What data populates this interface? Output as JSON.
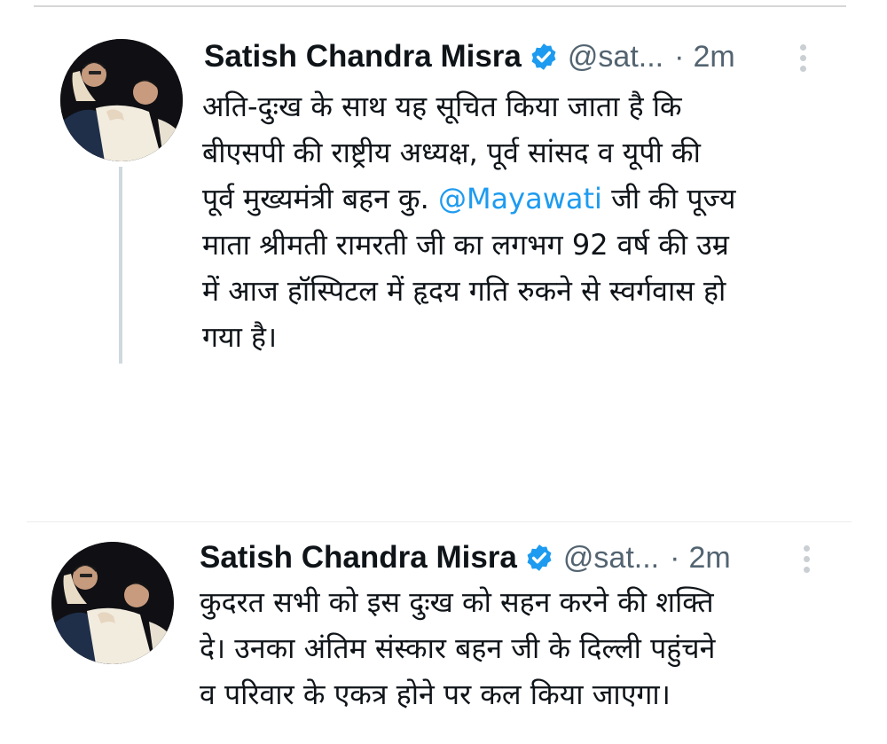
{
  "colors": {
    "accent": "#1d9bf0",
    "secondary_text": "#536471",
    "primary_text": "#0f1419",
    "verified_badge": "#1d9bf0"
  },
  "tweets": [
    {
      "author_name": "Satish Chandra Misra",
      "verified_icon": "verified-badge-icon",
      "handle": "@sat...",
      "separator": "·",
      "time": "2m",
      "lines": [
        {
          "pre": "अति-दुःख के साथ यह सूचित किया जाता है कि",
          "mention": "",
          "post": ""
        },
        {
          "pre": "बीएसपी की राष्ट्रीय अध्यक्ष, पूर्व सांसद व यूपी की",
          "mention": "",
          "post": ""
        },
        {
          "pre": "पूर्व मुख्यमंत्री बहन कु. ",
          "mention": "@Mayawati",
          "post": " जी की पूज्य"
        },
        {
          "pre": "माता श्रीमती रामरती जी का लगभग 92 वर्ष की उम्र",
          "mention": "",
          "post": ""
        },
        {
          "pre": "में आज हॉस्पिटल में हृदय गति रुकने से स्वर्गवास हो",
          "mention": "",
          "post": ""
        },
        {
          "pre": "गया है।",
          "mention": "",
          "post": ""
        }
      ]
    },
    {
      "author_name": "Satish Chandra Misra",
      "verified_icon": "verified-badge-icon",
      "handle": "@sat...",
      "separator": "·",
      "time": "2m",
      "lines": [
        {
          "pre": "कुदरत सभी को इस दुःख को सहन करने की शक्ति",
          "mention": "",
          "post": ""
        },
        {
          "pre": "दे। उनका अंतिम संस्कार बहन जी के दिल्ली पहुंचने",
          "mention": "",
          "post": ""
        },
        {
          "pre": "व परिवार के एकत्र होने पर कल किया जाएगा।",
          "mention": "",
          "post": ""
        }
      ]
    }
  ]
}
